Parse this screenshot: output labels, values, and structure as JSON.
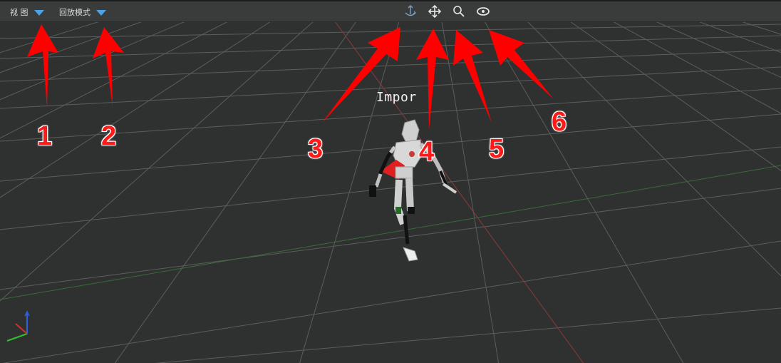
{
  "toolbar": {
    "view_menu_label": "视 图",
    "playback_menu_label": "回放模式",
    "tools": [
      {
        "name": "rotate-axis-icon"
      },
      {
        "name": "move-icon"
      },
      {
        "name": "zoom-icon"
      },
      {
        "name": "eye-icon"
      }
    ]
  },
  "viewport": {
    "model_label": "Impor",
    "grid_color": "#6a6c6c",
    "background_color": "#2f3131",
    "axis_colors": {
      "x": "#d03030",
      "y": "#30c030",
      "z": "#3060e0"
    }
  },
  "annotations": {
    "arrow_color": "#ff0000",
    "labels": [
      "1",
      "2",
      "3",
      "4",
      "5",
      "6"
    ]
  }
}
